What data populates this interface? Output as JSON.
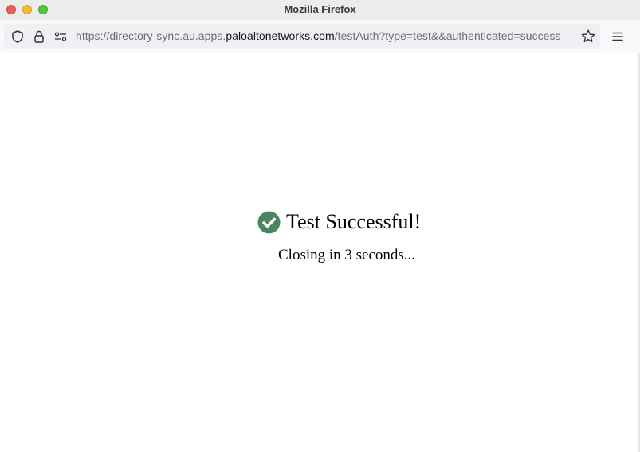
{
  "window": {
    "title": "Mozilla Firefox",
    "buttons": {
      "close": "close-window",
      "minimize": "minimize-window",
      "maximize": "maximize-window"
    }
  },
  "toolbar": {
    "url_prefix": "https://directory-sync.au.apps.",
    "url_domain": "paloaltonetworks.com",
    "url_suffix": "/testAuth?type=test&&authenticated=success",
    "icons": [
      "shield-icon",
      "lock-icon",
      "permissions-icon",
      "bookmark-star-icon",
      "hamburger-menu-icon"
    ]
  },
  "page": {
    "status_title": "Test Successful!",
    "countdown_text": "Closing in 3 seconds...",
    "status_icon": "check-circle-icon",
    "colors": {
      "success": "#4a8561"
    }
  }
}
